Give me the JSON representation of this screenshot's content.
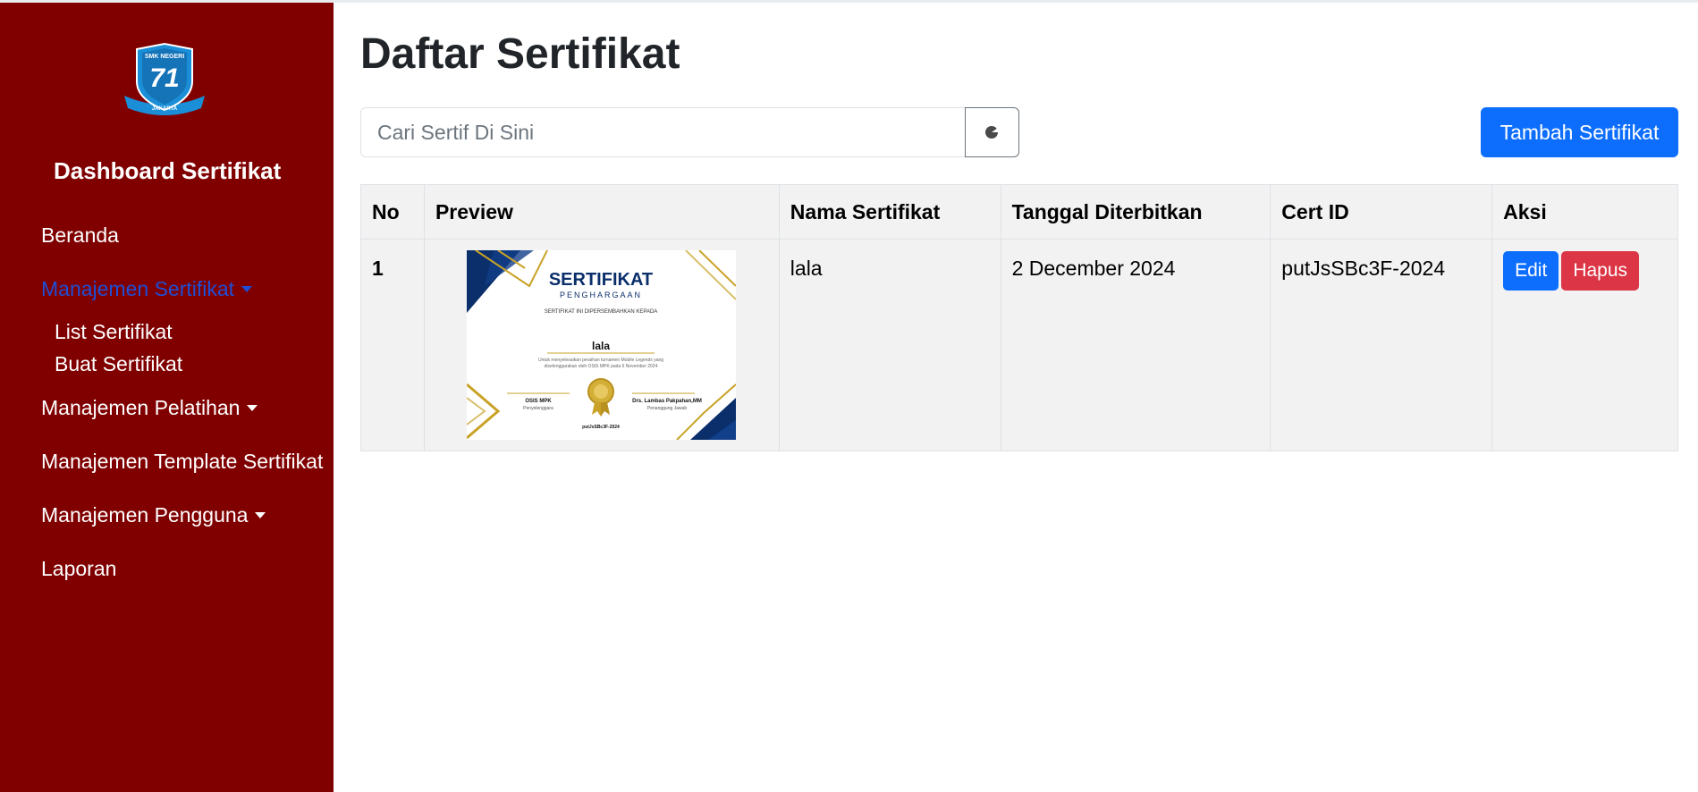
{
  "sidebar": {
    "logo": {
      "top_text": "SMK NEGERI",
      "number": "71",
      "bottom_text": "JAKARTA"
    },
    "brand": "Dashboard Sertifikat",
    "items": [
      {
        "label": "Beranda"
      },
      {
        "label": "Manajemen Sertifikat",
        "active": true,
        "dropdown": true,
        "sub": [
          {
            "label": "List Sertifikat"
          },
          {
            "label": "Buat Sertifikat"
          }
        ]
      },
      {
        "label": "Manajemen Pelatihan",
        "dropdown": true
      },
      {
        "label": "Manajemen Template Sertifikat"
      },
      {
        "label": "Manajemen Pengguna",
        "dropdown": true
      },
      {
        "label": "Laporan"
      }
    ]
  },
  "main": {
    "title": "Daftar Sertifikat",
    "search": {
      "placeholder": "Cari Sertif Di Sini",
      "value": ""
    },
    "add_button": "Tambah Sertifikat",
    "table": {
      "headers": [
        "No",
        "Preview",
        "Nama Sertifikat",
        "Tanggal Diterbitkan",
        "Cert ID",
        "Aksi"
      ],
      "rows": [
        {
          "no": "1",
          "nama": "lala",
          "tanggal": "2 December 2024",
          "cert_id": "putJsSBc3F-2024",
          "actions": {
            "edit": "Edit",
            "delete": "Hapus"
          },
          "preview": {
            "title": "SERTIFIKAT",
            "subtitle": "PENGHARGAAN",
            "presented": "SERTIFIKAT INI DIPERSEMBAHKAN KEPADA",
            "recipient": "lala",
            "description_1": "Untuk menyelesaikan peraihan turnamen Mobile Legends yang",
            "description_2": "diselenggarakan oleh OSIS MPK pada 6 November 2024",
            "left_sign_name": "OSIS MPK",
            "left_sign_role": "Penyelenggara",
            "right_sign_name": "Drs. Lambas Pakpahan,MM",
            "right_sign_role": "Penanggung Jawab",
            "cert_code": "putJsSBc3F-2024"
          }
        }
      ]
    }
  },
  "colors": {
    "sidebar_bg": "#800000",
    "primary": "#0d6efd",
    "danger": "#dc3545",
    "active_link": "#1f4fd6",
    "cert_navy": "#0b2f6b",
    "cert_gold": "#c9a227"
  },
  "icons": {
    "search_button": "search-icon"
  }
}
